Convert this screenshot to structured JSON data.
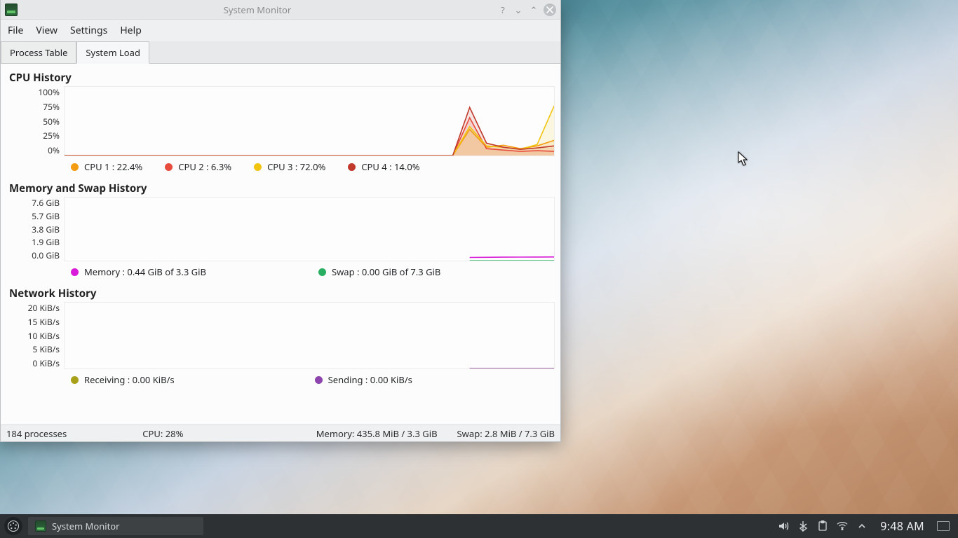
{
  "window": {
    "title": "System Monitor",
    "menus": [
      "File",
      "View",
      "Settings",
      "Help"
    ],
    "tabs": [
      {
        "label": "Process Table",
        "active": false
      },
      {
        "label": "System Load",
        "active": true
      }
    ]
  },
  "cpu": {
    "title": "CPU History",
    "yticks": [
      "100%",
      "75%",
      "50%",
      "25%",
      "0%"
    ],
    "legend": [
      {
        "label": "CPU 1 : 22.4%",
        "color": "#f39c12"
      },
      {
        "label": "CPU 2 : 6.3%",
        "color": "#e74c3c"
      },
      {
        "label": "CPU 3 : 72.0%",
        "color": "#f1c40f"
      },
      {
        "label": "CPU 4 : 14.0%",
        "color": "#c0392b"
      }
    ]
  },
  "memory": {
    "title": "Memory and Swap History",
    "yticks": [
      "7.6 GiB",
      "5.7 GiB",
      "3.8 GiB",
      "1.9 GiB",
      "0.0 GiB"
    ],
    "legend": [
      {
        "label": "Memory : 0.44 GiB of 3.3 GiB",
        "color": "#d81bd8"
      },
      {
        "label": "Swap : 0.00 GiB of 7.3 GiB",
        "color": "#27ae60"
      }
    ]
  },
  "network": {
    "title": "Network History",
    "yticks": [
      "20 KiB/s",
      "15 KiB/s",
      "10 KiB/s",
      "5 KiB/s",
      "0 KiB/s"
    ],
    "legend": [
      {
        "label": "Receiving : 0.00 KiB/s",
        "color": "#a9a019"
      },
      {
        "label": "Sending : 0.00 KiB/s",
        "color": "#8d44ad"
      }
    ]
  },
  "status": {
    "processes": "184 processes",
    "cpu": "CPU: 28%",
    "memory": "Memory: 435.8 MiB / 3.3 GiB",
    "swap": "Swap: 2.8 MiB / 7.3 GiB"
  },
  "panel": {
    "task": "System Monitor",
    "clock": "9:48 AM"
  },
  "chart_data": [
    {
      "type": "line",
      "title": "CPU History",
      "xlabel": "",
      "ylabel": "",
      "ylim": [
        0,
        100
      ],
      "yticks": [
        0,
        25,
        50,
        75,
        100
      ],
      "x": [
        0,
        1,
        2,
        3,
        4,
        5,
        6,
        7,
        8,
        9,
        10,
        11,
        12,
        13,
        14,
        15,
        16,
        17,
        18,
        19,
        20,
        21,
        22,
        23,
        24,
        25,
        26,
        27,
        28,
        29
      ],
      "series": [
        {
          "name": "CPU 1",
          "color": "#f39c12",
          "values": [
            0,
            0,
            0,
            0,
            0,
            0,
            0,
            0,
            0,
            0,
            0,
            0,
            0,
            0,
            0,
            0,
            0,
            0,
            0,
            0,
            0,
            0,
            0,
            0,
            38,
            12,
            15,
            10,
            14,
            22
          ]
        },
        {
          "name": "CPU 2",
          "color": "#e74c3c",
          "values": [
            0,
            0,
            0,
            0,
            0,
            0,
            0,
            0,
            0,
            0,
            0,
            0,
            0,
            0,
            0,
            0,
            0,
            0,
            0,
            0,
            0,
            0,
            0,
            0,
            55,
            10,
            8,
            6,
            7,
            6
          ]
        },
        {
          "name": "CPU 3",
          "color": "#f1c40f",
          "values": [
            0,
            0,
            0,
            0,
            0,
            0,
            0,
            0,
            0,
            0,
            0,
            0,
            0,
            0,
            0,
            0,
            0,
            0,
            0,
            0,
            0,
            0,
            0,
            0,
            42,
            14,
            12,
            9,
            16,
            72
          ]
        },
        {
          "name": "CPU 4",
          "color": "#c0392b",
          "values": [
            0,
            0,
            0,
            0,
            0,
            0,
            0,
            0,
            0,
            0,
            0,
            0,
            0,
            0,
            0,
            0,
            0,
            0,
            0,
            0,
            0,
            0,
            0,
            0,
            70,
            18,
            12,
            9,
            11,
            14
          ]
        }
      ],
      "legend_labels": [
        "CPU 1 : 22.4%",
        "CPU 2 : 6.3%",
        "CPU 3 : 72.0%",
        "CPU 4 : 14.0%"
      ]
    },
    {
      "type": "line",
      "title": "Memory and Swap History",
      "xlabel": "",
      "ylabel": "",
      "ylim": [
        0,
        7.6
      ],
      "yticks": [
        0,
        1.9,
        3.8,
        5.7,
        7.6
      ],
      "x": [
        0,
        1,
        2,
        3,
        4,
        5,
        6,
        7,
        8,
        9,
        10,
        11,
        12,
        13,
        14,
        15,
        16,
        17,
        18,
        19,
        20,
        21,
        22,
        23,
        24,
        25,
        26,
        27,
        28,
        29
      ],
      "series": [
        {
          "name": "Memory",
          "color": "#d81bd8",
          "values": [
            null,
            null,
            null,
            null,
            null,
            null,
            null,
            null,
            null,
            null,
            null,
            null,
            null,
            null,
            null,
            null,
            null,
            null,
            null,
            null,
            null,
            null,
            null,
            null,
            0.38,
            0.4,
            0.41,
            0.42,
            0.43,
            0.44
          ]
        },
        {
          "name": "Swap",
          "color": "#27ae60",
          "values": [
            null,
            null,
            null,
            null,
            null,
            null,
            null,
            null,
            null,
            null,
            null,
            null,
            null,
            null,
            null,
            null,
            null,
            null,
            null,
            null,
            null,
            null,
            null,
            null,
            0.0,
            0.0,
            0.0,
            0.0,
            0.0,
            0.0
          ]
        }
      ],
      "legend_labels": [
        "Memory : 0.44 GiB of 3.3 GiB",
        "Swap : 0.00 GiB of 7.3 GiB"
      ]
    },
    {
      "type": "line",
      "title": "Network History",
      "xlabel": "",
      "ylabel": "",
      "ylim": [
        0,
        20
      ],
      "yticks": [
        0,
        5,
        10,
        15,
        20
      ],
      "x": [
        0,
        1,
        2,
        3,
        4,
        5,
        6,
        7,
        8,
        9,
        10,
        11,
        12,
        13,
        14,
        15,
        16,
        17,
        18,
        19,
        20,
        21,
        22,
        23,
        24,
        25,
        26,
        27,
        28,
        29
      ],
      "series": [
        {
          "name": "Receiving",
          "color": "#a9a019",
          "values": [
            null,
            null,
            null,
            null,
            null,
            null,
            null,
            null,
            null,
            null,
            null,
            null,
            null,
            null,
            null,
            null,
            null,
            null,
            null,
            null,
            null,
            null,
            null,
            null,
            0,
            0,
            0,
            0,
            0,
            0
          ]
        },
        {
          "name": "Sending",
          "color": "#8d44ad",
          "values": [
            null,
            null,
            null,
            null,
            null,
            null,
            null,
            null,
            null,
            null,
            null,
            null,
            null,
            null,
            null,
            null,
            null,
            null,
            null,
            null,
            null,
            null,
            null,
            null,
            0,
            0,
            0,
            0,
            0,
            0
          ]
        }
      ],
      "legend_labels": [
        "Receiving : 0.00 KiB/s",
        "Sending : 0.00 KiB/s"
      ]
    }
  ]
}
